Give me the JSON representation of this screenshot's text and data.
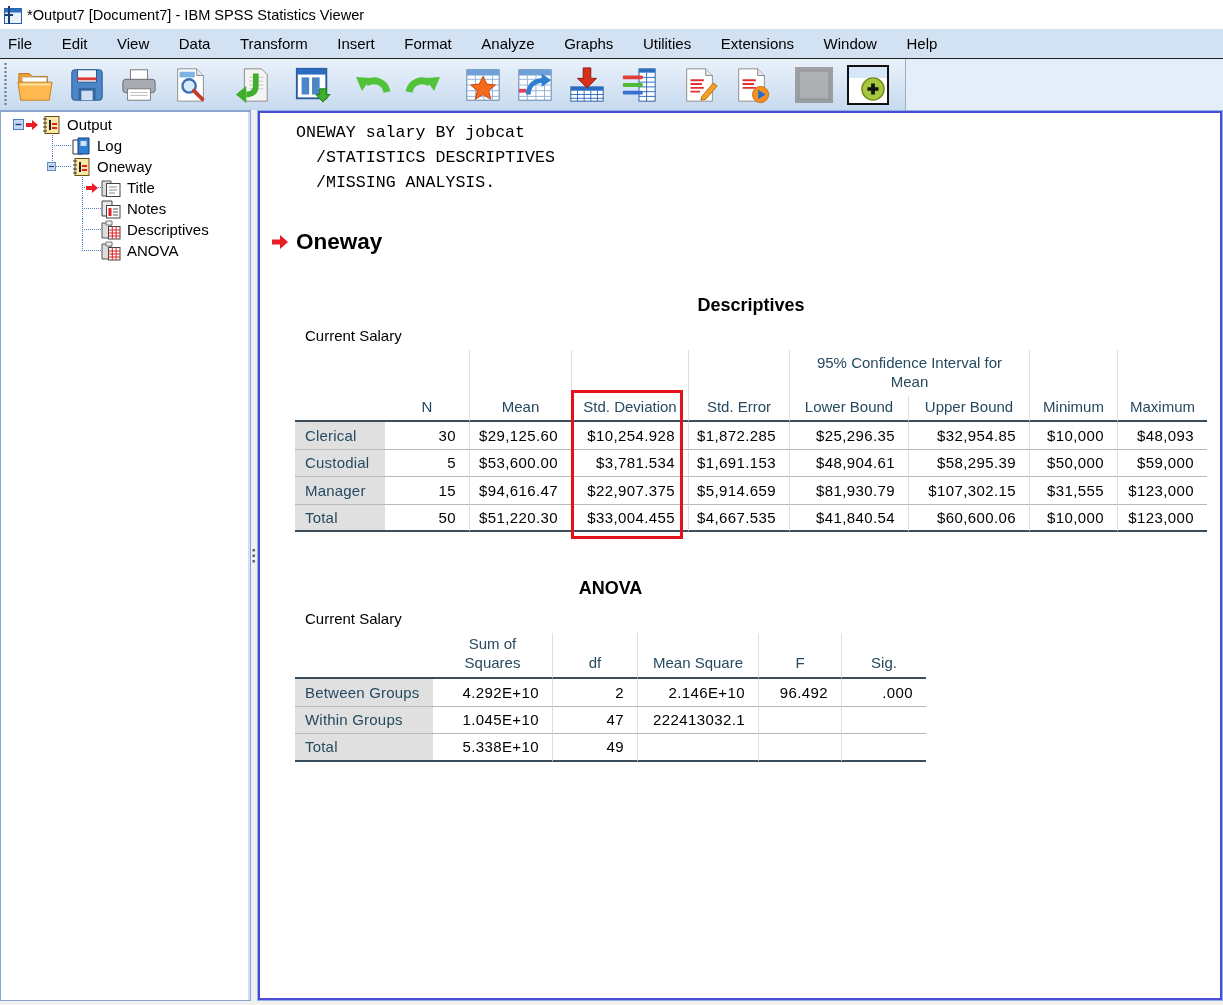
{
  "window": {
    "title": "*Output7 [Document7] - IBM SPSS Statistics Viewer"
  },
  "menu": [
    "File",
    "Edit",
    "View",
    "Data",
    "Transform",
    "Insert",
    "Format",
    "Analyze",
    "Graphs",
    "Utilities",
    "Extensions",
    "Window",
    "Help"
  ],
  "toolbar": {
    "groups": [
      [
        {
          "kind": "folder",
          "disabled": false,
          "pressed": false
        },
        {
          "kind": "floppy",
          "disabled": false,
          "pressed": false
        },
        {
          "kind": "printer",
          "disabled": false,
          "pressed": false
        },
        {
          "kind": "preview",
          "disabled": false,
          "pressed": false
        }
      ],
      [
        {
          "kind": "export",
          "disabled": false,
          "pressed": false
        }
      ],
      [
        {
          "kind": "window",
          "disabled": false,
          "pressed": false
        }
      ],
      [
        {
          "kind": "undo",
          "disabled": false,
          "pressed": false
        },
        {
          "kind": "redo",
          "disabled": false,
          "pressed": false
        }
      ],
      [
        {
          "kind": "star",
          "disabled": false,
          "pressed": false
        },
        {
          "kind": "pivot",
          "disabled": false,
          "pressed": false
        },
        {
          "kind": "download",
          "disabled": false,
          "pressed": false
        },
        {
          "kind": "bars",
          "disabled": false,
          "pressed": false
        }
      ],
      [
        {
          "kind": "edit",
          "disabled": false,
          "pressed": false
        },
        {
          "kind": "play",
          "disabled": false,
          "pressed": false
        }
      ],
      [
        {
          "kind": "blank",
          "disabled": true,
          "pressed": false
        },
        {
          "kind": "plus",
          "disabled": false,
          "pressed": true
        }
      ]
    ]
  },
  "tree": [
    {
      "label": "Output",
      "kind": "heading",
      "current": true,
      "selected": false,
      "expanded": true,
      "children": [
        {
          "label": "Log",
          "kind": "log",
          "current": false,
          "selected": false
        },
        {
          "label": "Oneway",
          "kind": "heading",
          "current": false,
          "selected": false,
          "expanded": true,
          "children": [
            {
              "label": "Title",
              "kind": "title",
              "current": true,
              "selected": false
            },
            {
              "label": "Notes",
              "kind": "notes",
              "current": false,
              "selected": false
            },
            {
              "label": "Descriptives",
              "kind": "table",
              "current": false,
              "selected": false
            },
            {
              "label": "ANOVA",
              "kind": "table",
              "current": false,
              "selected": false
            }
          ]
        }
      ]
    }
  ],
  "output": {
    "syntax": [
      "ONEWAY salary BY jobcat",
      "/STATISTICS DESCRIPTIVES",
      "/MISSING ANALYSIS."
    ],
    "heading": {
      "text": "Oneway",
      "current": true
    },
    "tables": [
      {
        "title": "Descriptives",
        "caption": "Current Salary",
        "group_label": "95% Confidence Interval for Mean",
        "columns": [
          {
            "label": "N",
            "in_group": false,
            "highlighted": false
          },
          {
            "label": "Mean",
            "in_group": false,
            "highlighted": false
          },
          {
            "label": "Std. Deviation",
            "in_group": false,
            "highlighted": true
          },
          {
            "label": "Std. Error",
            "in_group": false,
            "highlighted": false
          },
          {
            "label": "Lower Bound",
            "in_group": true,
            "highlighted": false
          },
          {
            "label": "Upper Bound",
            "in_group": true,
            "highlighted": false
          },
          {
            "label": "Minimum",
            "in_group": false,
            "highlighted": false
          },
          {
            "label": "Maximum",
            "in_group": false,
            "highlighted": false
          }
        ],
        "rows": [
          {
            "label": "Clerical",
            "cells": [
              "30",
              "$29,125.60",
              "$10,254.928",
              "$1,872.285",
              "$25,296.35",
              "$32,954.85",
              "$10,000",
              "$48,093"
            ]
          },
          {
            "label": "Custodial",
            "cells": [
              "5",
              "$53,600.00",
              "$3,781.534",
              "$1,691.153",
              "$48,904.61",
              "$58,295.39",
              "$50,000",
              "$59,000"
            ]
          },
          {
            "label": "Manager",
            "cells": [
              "15",
              "$94,616.47",
              "$22,907.375",
              "$5,914.659",
              "$81,930.79",
              "$107,302.15",
              "$31,555",
              "$123,000"
            ]
          },
          {
            "label": "Total",
            "cells": [
              "50",
              "$51,220.30",
              "$33,004.455",
              "$4,667.535",
              "$41,840.54",
              "$60,600.06",
              "$10,000",
              "$123,000"
            ]
          }
        ]
      },
      {
        "title": "ANOVA",
        "caption": "Current Salary",
        "columns": [
          {
            "label": "Sum of Squares",
            "in_group": false,
            "highlighted": false
          },
          {
            "label": "df",
            "in_group": false,
            "highlighted": false
          },
          {
            "label": "Mean Square",
            "in_group": false,
            "highlighted": false
          },
          {
            "label": "F",
            "in_group": false,
            "highlighted": false
          },
          {
            "label": "Sig.",
            "in_group": false,
            "highlighted": false
          }
        ],
        "rows": [
          {
            "label": "Between Groups",
            "cells": [
              "4.292E+10",
              "2",
              "2.146E+10",
              "96.492",
              ".000"
            ]
          },
          {
            "label": "Within Groups",
            "cells": [
              "1.045E+10",
              "47",
              "222413032.1"
            ]
          },
          {
            "label": "Total",
            "cells": [
              "5.338E+10",
              "49"
            ]
          }
        ]
      }
    ]
  }
}
